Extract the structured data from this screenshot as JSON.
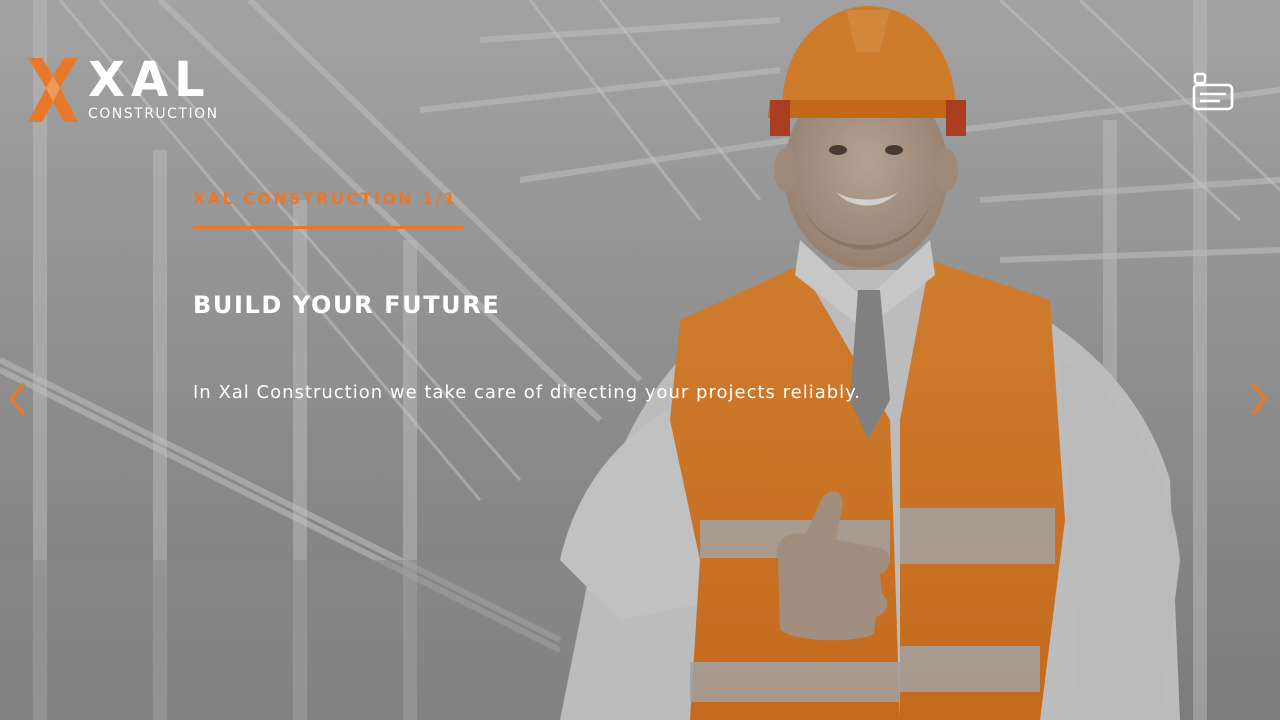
{
  "brand": {
    "name": "XAL",
    "tagline": "CONSTRUCTION",
    "accent_color": "#e8792a"
  },
  "header": {
    "menu_icon": "menu-card-icon"
  },
  "slide": {
    "eyebrow": "XAL CONSTRUCTION 1/1",
    "headline": "BUILD YOUR FUTURE",
    "subtext": "In Xal Construction we take care of directing your projects reliably."
  },
  "navigation": {
    "prev_icon": "chevron-left-icon",
    "next_icon": "chevron-right-icon"
  }
}
